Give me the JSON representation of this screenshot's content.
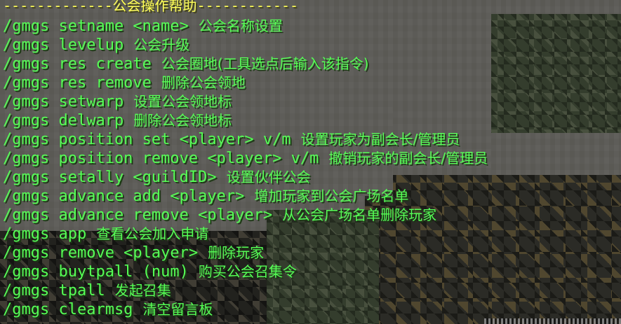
{
  "chat": {
    "title": "-------------公会操作帮助------------",
    "lines": [
      {
        "command": "/gmgs setname <name>",
        "description": "公会名称设置"
      },
      {
        "command": "/gmgs levelup",
        "description": "公会升级"
      },
      {
        "command": "/gmgs res create",
        "description": "公会圈地(工具选点后输入该指令)"
      },
      {
        "command": "/gmgs res remove",
        "description": "删除公会领地"
      },
      {
        "command": "/gmgs setwarp",
        "description": "设置公会领地标"
      },
      {
        "command": "/gmgs delwarp",
        "description": "删除公会领地标"
      },
      {
        "command": "/gmgs position set <player> v/m",
        "description": "设置玩家为副会长/管理员"
      },
      {
        "command": "/gmgs position remove <player> v/m",
        "description": "撤销玩家的副会长/管理员"
      },
      {
        "command": "/gmgs setally <guildID>",
        "description": "设置伙伴公会"
      },
      {
        "command": "/gmgs advance add <player>",
        "description": "增加玩家到公会广场名单"
      },
      {
        "command": "/gmgs advance remove <player>",
        "description": "从公会广场名单删除玩家"
      },
      {
        "command": "/gmgs app",
        "description": "查看公会加入申请"
      },
      {
        "command": "/gmgs remove <player>",
        "description": "删除玩家"
      },
      {
        "command": "/gmgs buytpall (num)",
        "description": "购买公会召集令"
      },
      {
        "command": "/gmgs tpall",
        "description": "发起召集"
      },
      {
        "command": "/gmgs clearmsg",
        "description": "清空留言板"
      }
    ]
  },
  "colors": {
    "command_text": "#55ff55",
    "title_text": "#ffff55"
  }
}
